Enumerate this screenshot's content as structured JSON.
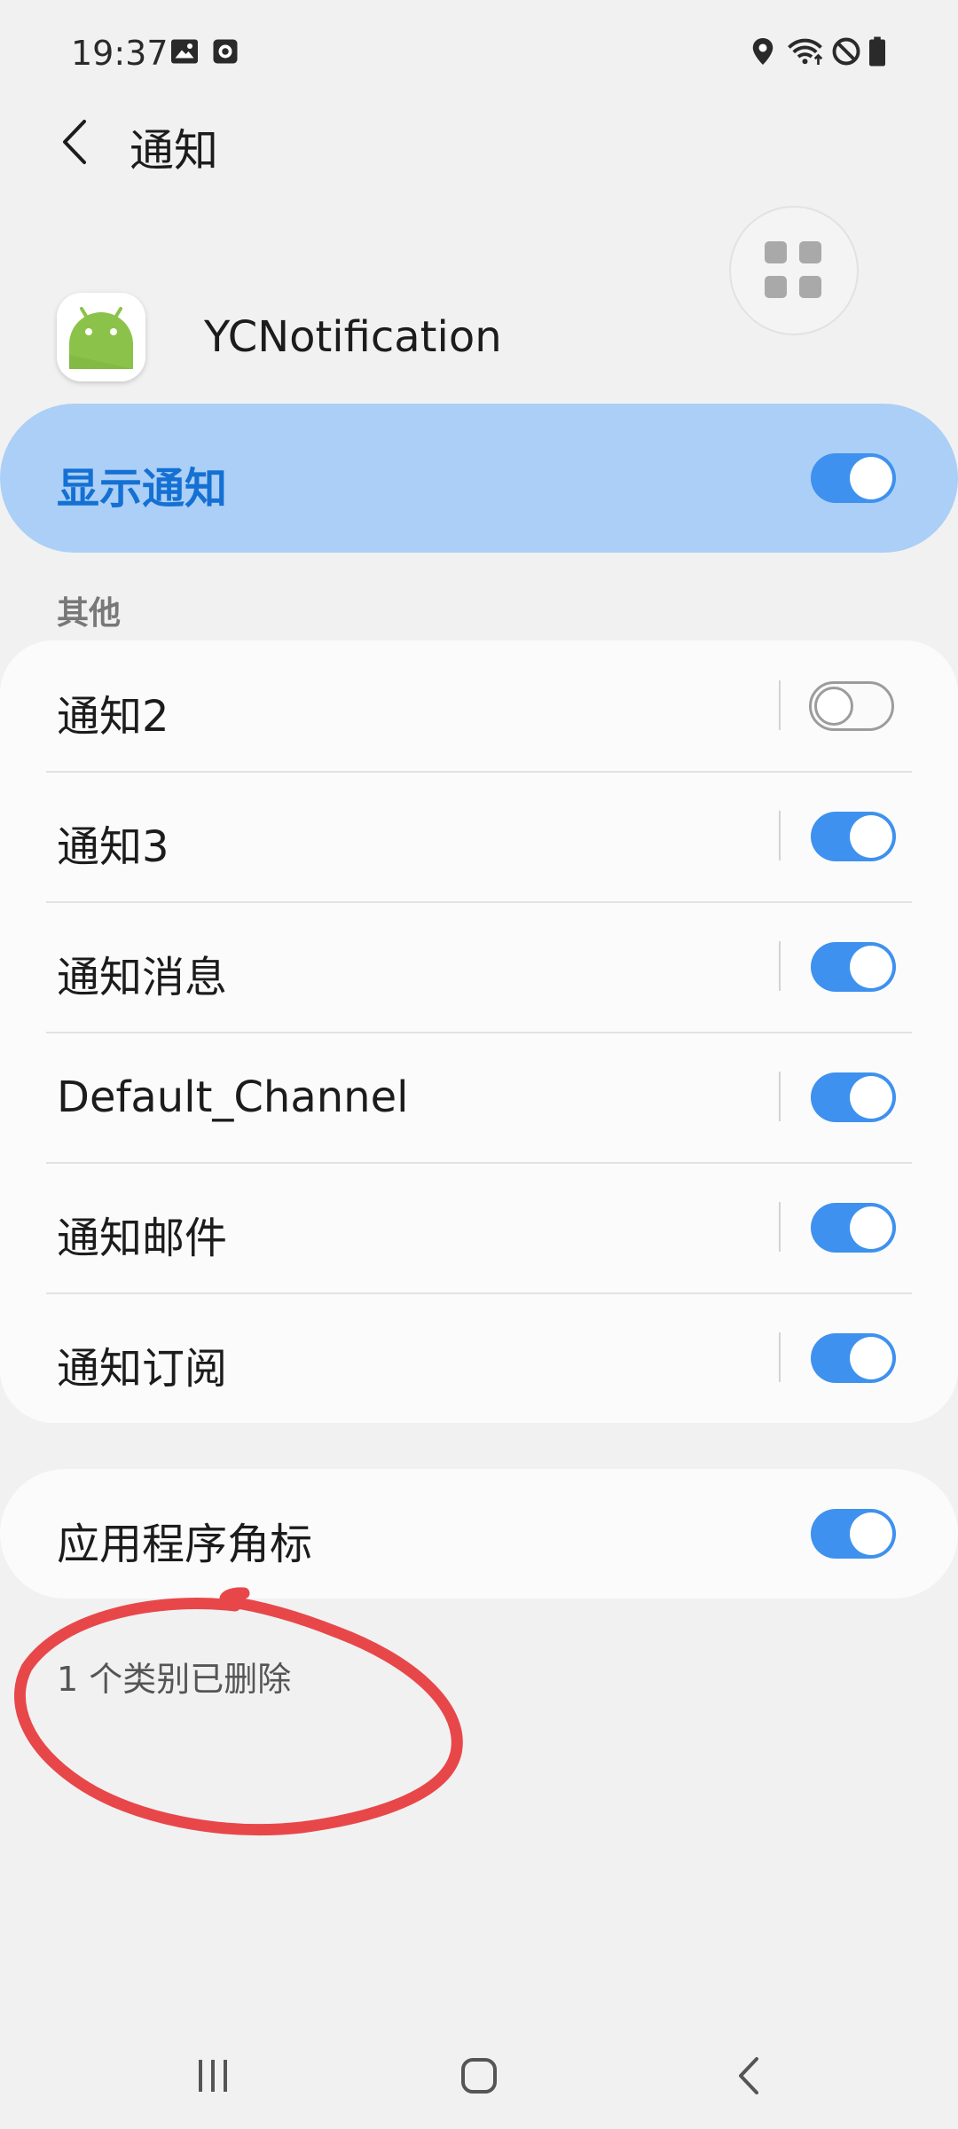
{
  "status_bar": {
    "time": "19:37",
    "left_icons": [
      "gallery-icon",
      "screen-recorder-icon"
    ],
    "right_icons": [
      "location-icon",
      "wifi-icon",
      "do-not-disturb-icon",
      "battery-icon"
    ]
  },
  "header": {
    "title": "通知",
    "back_icon": "chevron-left-icon"
  },
  "app": {
    "name": "YCNotification",
    "icon": "android-icon"
  },
  "show_notifications": {
    "label": "显示通知",
    "enabled": true
  },
  "categories": {
    "header": "其他",
    "items": [
      {
        "label": "通知2",
        "enabled": false
      },
      {
        "label": "通知3",
        "enabled": true
      },
      {
        "label": "通知消息",
        "enabled": true
      },
      {
        "label": "Default_Channel",
        "enabled": true
      },
      {
        "label": "通知邮件",
        "enabled": true
      },
      {
        "label": "通知订阅",
        "enabled": true
      }
    ]
  },
  "app_badge": {
    "label": "应用程序角标",
    "enabled": true
  },
  "deleted_note": "1 个类别已删除",
  "colors": {
    "accent": "#3e91ee",
    "highlight_card": "#abcff7",
    "highlight_text": "#1570d3",
    "annotation": "#e8474a"
  },
  "nav_bar": {
    "icons": [
      "recent-apps-icon",
      "home-icon",
      "back-icon"
    ]
  }
}
